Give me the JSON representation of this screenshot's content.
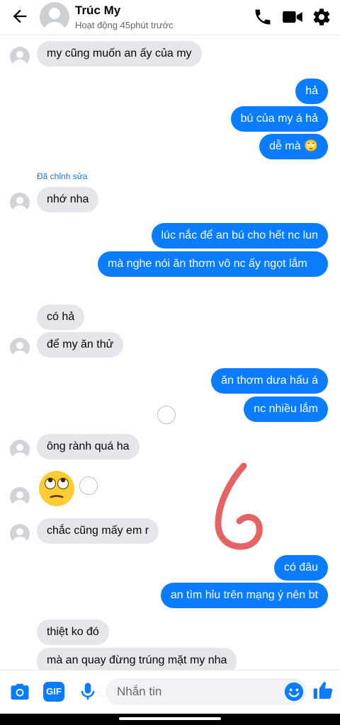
{
  "header": {
    "contact_name": "Trúc My",
    "status": "Hoạt động 45phút trước",
    "icons": [
      "back-arrow-icon",
      "phone-icon",
      "video-camera-icon",
      "gear-icon"
    ]
  },
  "messages": [
    {
      "from": "them",
      "text": "my cũng muốn an ấy của my"
    },
    {
      "from": "me",
      "text": "hả"
    },
    {
      "from": "me",
      "text": "bú của my á hả"
    },
    {
      "from": "me",
      "text": "dễ mà 🙄"
    },
    {
      "from": "them",
      "text": "nhớ nha",
      "note": "Đã chỉnh sửa"
    },
    {
      "from": "me",
      "text": "lúc nắc để an bú cho hết nc lun"
    },
    {
      "from": "me",
      "text": "mà nghe nói ăn thơm vô nc ấy ngọt lắm"
    },
    {
      "from": "them",
      "text": "có hả"
    },
    {
      "from": "them",
      "text": "để my ăn thử"
    },
    {
      "from": "me",
      "text": "ăn thơm dưa hấu á"
    },
    {
      "from": "me",
      "text": "nc nhiều lắm"
    },
    {
      "from": "them",
      "text": "ông rành quá ha"
    },
    {
      "from": "them",
      "text": "🙄"
    },
    {
      "from": "them",
      "text": "chắc cũng mấy em r"
    },
    {
      "from": "me",
      "text": "có đâu"
    },
    {
      "from": "me",
      "text": "an tìm hỉu trên mạng ý nên bt"
    },
    {
      "from": "them",
      "text": "thiệt ko đó"
    },
    {
      "from": "them",
      "text": "mà an quay đừng trúng mặt my nha"
    }
  ],
  "composer": {
    "placeholder": "Nhắn tin",
    "gif_label": "GIF",
    "icons": [
      "camera-icon",
      "gif-icon",
      "microphone-icon",
      "emoji-icon",
      "thumbs-up-icon"
    ]
  },
  "colors": {
    "accent": "#0a7cff",
    "incoming_bubble": "#e4e6eb",
    "scribble": "#e04848"
  }
}
